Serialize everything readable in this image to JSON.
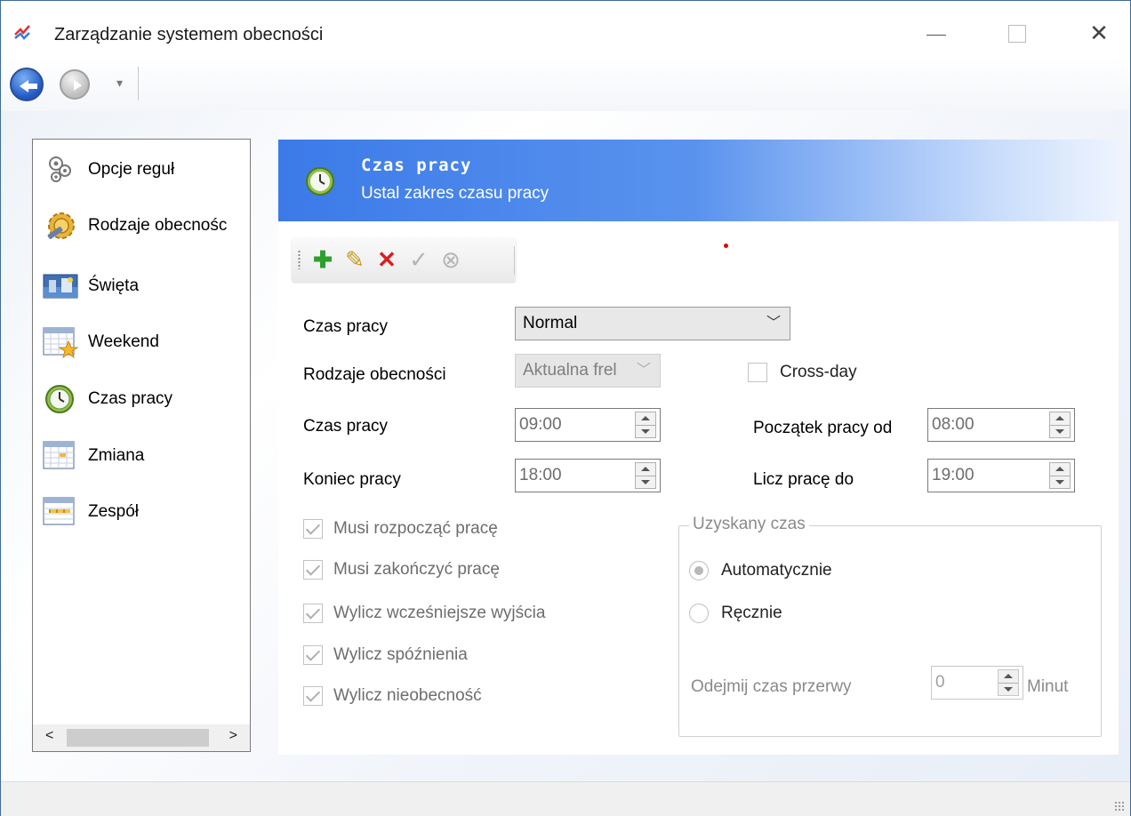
{
  "window": {
    "title": "Zarządzanie systemem obecności",
    "controls": {
      "minimize": "—",
      "maximize": "□",
      "close": "✕"
    }
  },
  "nav": {
    "dropdown": "▾"
  },
  "sidebar": {
    "items": [
      {
        "label": "Opcje reguł",
        "icon": "gears-icon"
      },
      {
        "label": "Rodzaje obecnośc",
        "icon": "settings-gear-icon"
      },
      {
        "label": "Święta",
        "icon": "holiday-image-icon"
      },
      {
        "label": "Weekend",
        "icon": "calendar-star-icon"
      },
      {
        "label": "Czas pracy",
        "icon": "clock-icon"
      },
      {
        "label": "Zmiana",
        "icon": "calendar-grid-icon"
      },
      {
        "label": "Zespół",
        "icon": "calendar-team-icon"
      }
    ],
    "scroll_left": "<",
    "scroll_right": ">"
  },
  "banner": {
    "title": "Czas pracy",
    "subtitle": "Ustal zakres czasu pracy"
  },
  "toolbar": {
    "add": "✚",
    "edit": "✎",
    "delete": "✕",
    "save": "✓",
    "cancel": "⊗"
  },
  "form": {
    "work_time_label": "Czas pracy",
    "work_time_value": "Normal",
    "attendance_types_label": "Rodzaje obecności",
    "attendance_types_value": "Aktualna frel",
    "cross_day_label": "Cross-day",
    "start_label": "Czas pracy",
    "start_value": "09:00",
    "end_label": "Koniec pracy",
    "end_value": "18:00",
    "work_from_label": "Początek pracy od",
    "work_from_value": "08:00",
    "count_until_label": "Licz pracę do",
    "count_until_value": "19:00",
    "checkboxes": [
      {
        "label": "Musi rozpocząć pracę",
        "checked": true
      },
      {
        "label": "Musi zakończyć pracę",
        "checked": true
      },
      {
        "label": "Wylicz wcześniejsze wyjścia",
        "checked": true
      },
      {
        "label": "Wylicz spóźnienia",
        "checked": true
      },
      {
        "label": "Wylicz nieobecność",
        "checked": true
      }
    ]
  },
  "obtained_time": {
    "title": "Uzyskany czas",
    "auto_label": "Automatycznie",
    "manual_label": "Ręcznie",
    "selected": "Automatycznie",
    "break_label": "Odejmij czas przerwy",
    "break_value": "0",
    "break_unit": "Minut"
  },
  "colors": {
    "banner_start": "#3b7ae8",
    "banner_end": "#eef4fe",
    "add_green": "#2e9e2e",
    "delete_red": "#d62020"
  }
}
